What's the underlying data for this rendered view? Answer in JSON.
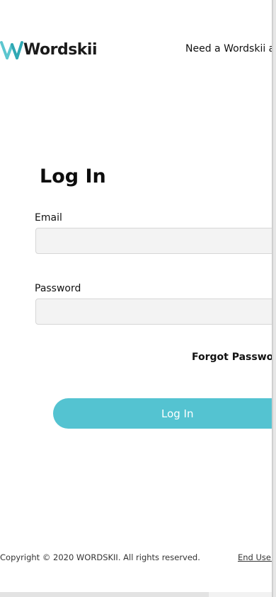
{
  "header": {
    "logo_text": "Wordskii",
    "need_account_text": "Need a Wordskii ac"
  },
  "login": {
    "title": "Log In",
    "email_label": "Email",
    "email_value": "",
    "password_label": "Password",
    "password_value": "",
    "forgot_password": "Forgot Passwor",
    "submit_label": "Log In"
  },
  "footer": {
    "copyright": "Copyright © 2020 WORDSKII. All rights reserved.",
    "eula_link": "End User"
  },
  "colors": {
    "accent": "#54c3d1",
    "input_background": "#f3f3f3"
  },
  "icons": {
    "logo_mark": "wordskii-logo-icon"
  }
}
